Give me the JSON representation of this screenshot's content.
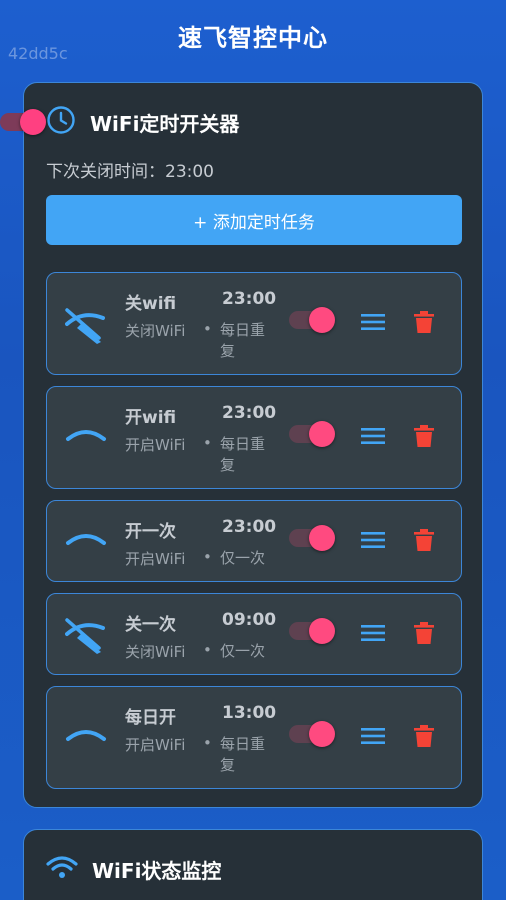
{
  "header": {
    "title": "速飞智控中心",
    "watermark": "42dd5c"
  },
  "timer_card": {
    "title": "WiFi定时开关器",
    "icon": "clock-icon",
    "master_enabled": true,
    "next_close_label": "下次关闭时间：",
    "next_close_time": "23:00",
    "add_button_label": "+ 添加定时任务",
    "tasks": [
      {
        "name": "关wifi",
        "time": "23:00",
        "action": "关闭WiFi",
        "dot": "•",
        "repeat": "每日重复",
        "icon": "wifi-off-icon",
        "enabled": true
      },
      {
        "name": "开wifi",
        "time": "23:00",
        "action": "开启WiFi",
        "dot": "•",
        "repeat": "每日重复",
        "icon": "wifi-on-icon",
        "enabled": true
      },
      {
        "name": "开一次",
        "time": "23:00",
        "action": "开启WiFi",
        "dot": "•",
        "repeat": "仅一次",
        "icon": "wifi-on-icon",
        "enabled": true
      },
      {
        "name": "关一次",
        "time": "09:00",
        "action": "关闭WiFi",
        "dot": "•",
        "repeat": "仅一次",
        "icon": "wifi-off-icon",
        "enabled": true
      },
      {
        "name": "每日开",
        "time": "13:00",
        "action": "开启WiFi",
        "dot": "•",
        "repeat": "每日重复",
        "icon": "wifi-on-icon",
        "enabled": true
      }
    ]
  },
  "monitor_card": {
    "title": "WiFi状态监控",
    "icon": "wifi-icon"
  },
  "colors": {
    "accent": "#42a5f5",
    "toggle_on": "#ff4081",
    "delete": "#f44336",
    "card_bg": "#263038",
    "card_border": "#3c86d8"
  }
}
